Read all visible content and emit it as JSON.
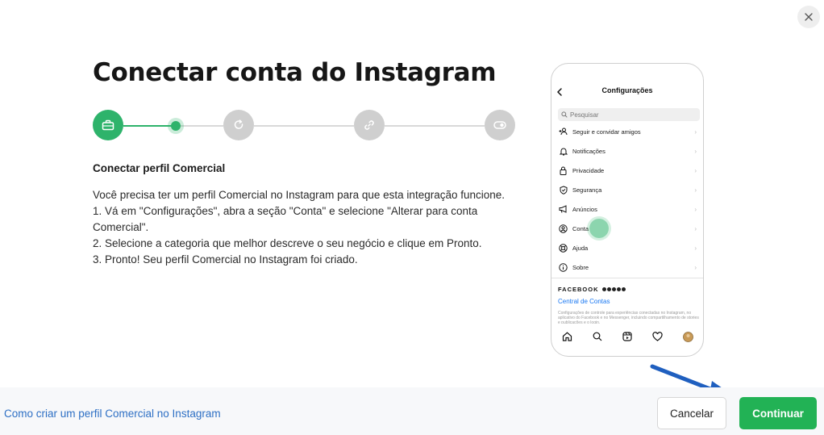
{
  "modal": {
    "title": "Conectar conta do Instagram",
    "section_title": "Conectar perfil Comercial",
    "body_lines": [
      "Você precisa ter um perfil Comercial no Instagram para que esta integração funcione.",
      "1. Vá em \"Configurações\", abra a seção \"Conta\" e selecione \"Alterar para conta Comercial\".",
      "2. Selecione a categoria que melhor descreve o seu negócio e clique em Pronto.",
      "3. Pronto! Seu perfil Comercial no Instagram foi criado."
    ],
    "colors": {
      "accent": "#2eb36b",
      "inactive": "#cfcfcf",
      "link": "#2d6fc4",
      "arrow": "#1f5fbf"
    }
  },
  "stepper": {
    "steps": [
      {
        "icon": "briefcase-icon",
        "state": "active"
      },
      {
        "icon": "refresh-icon",
        "state": "inactive"
      },
      {
        "icon": "link-icon",
        "state": "inactive"
      },
      {
        "icon": "toggle-icon",
        "state": "inactive"
      }
    ]
  },
  "phone": {
    "header": "Configurações",
    "search_placeholder": "Pesquisar",
    "items": [
      {
        "label": "Seguir e convidar amigos",
        "icon": "add-person-icon"
      },
      {
        "label": "Notificações",
        "icon": "bell-icon"
      },
      {
        "label": "Privacidade",
        "icon": "lock-icon"
      },
      {
        "label": "Segurança",
        "icon": "shield-icon"
      },
      {
        "label": "Anúncios",
        "icon": "megaphone-icon"
      },
      {
        "label": "Conta",
        "icon": "user-circle-icon"
      },
      {
        "label": "Ajuda",
        "icon": "lifebuoy-icon"
      },
      {
        "label": "Sobre",
        "icon": "info-icon"
      }
    ],
    "facebook_label": "FACEBOOK",
    "accounts_center": "Central de Contas",
    "small_text": "Configurações de controle para experiências conectadas no Instagram, no aplicativo do Facebook e no Messenger, incluindo compartilhamento de stories e publicações e o login.",
    "nav_icons": [
      "home-icon",
      "search-icon",
      "reels-icon",
      "heart-icon",
      "profile-icon"
    ]
  },
  "footer": {
    "help_link": "Como criar um perfil Comercial no Instagram",
    "cancel_label": "Cancelar",
    "continue_label": "Continuar"
  }
}
